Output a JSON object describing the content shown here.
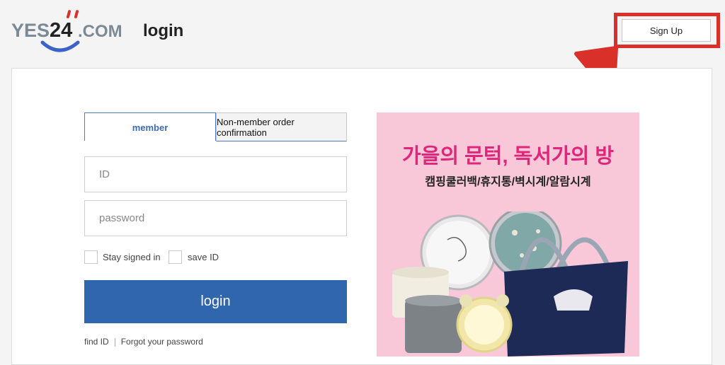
{
  "header": {
    "logo_text": "YES24.COM",
    "page_title": "login",
    "signup_label": "Sign Up"
  },
  "tabs": {
    "member": "member",
    "nonmember": "Non-member order confirmation"
  },
  "form": {
    "id_placeholder": "ID",
    "password_placeholder": "password",
    "stay_signed_in": "Stay signed in",
    "save_id": "save ID",
    "login_button": "login"
  },
  "links": {
    "find_id": "find ID",
    "forgot_password": "Forgot your password"
  },
  "banner": {
    "title": "가을의 문턱, 독서가의 방",
    "subtitle": "캠핑쿨러백/휴지통/벽시계/알람시계"
  },
  "colors": {
    "accent": "#2f66ae",
    "highlight": "#d9302a",
    "banner_bg": "#f8c8d8",
    "banner_title": "#e0267a"
  }
}
